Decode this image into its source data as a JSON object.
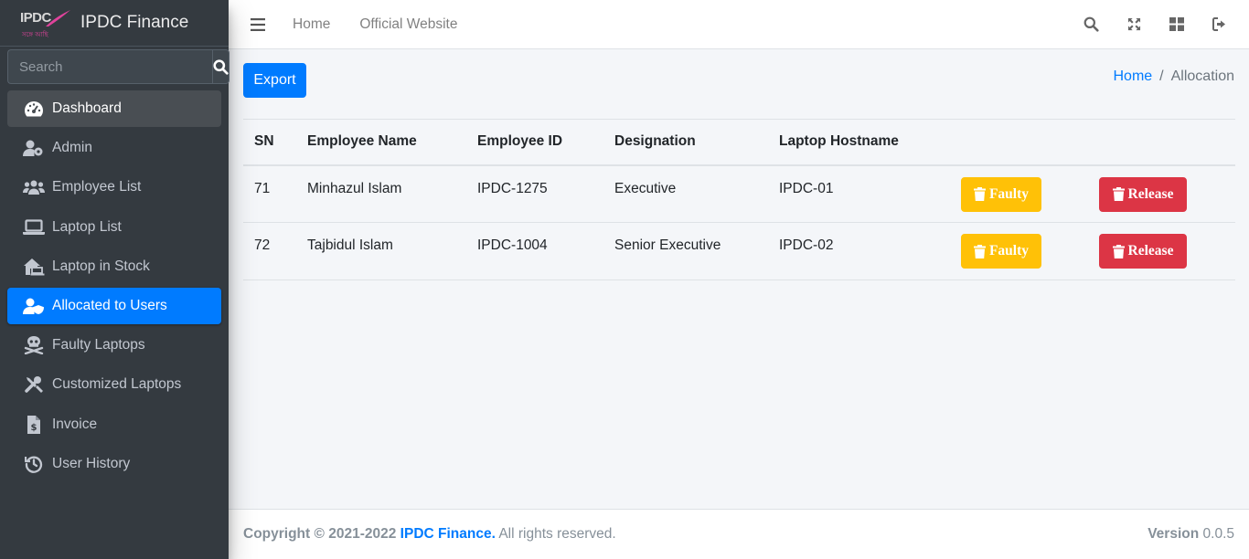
{
  "brand": {
    "logo_text": "IPDC",
    "logo_sub": "সঙ্গে আছি",
    "name": "IPDC Finance"
  },
  "search": {
    "placeholder": "Search"
  },
  "sidebar": {
    "items": [
      {
        "label": "Dashboard",
        "icon": "tachometer-icon"
      },
      {
        "label": "Admin",
        "icon": "user-cog-icon"
      },
      {
        "label": "Employee List",
        "icon": "users-icon"
      },
      {
        "label": "Laptop List",
        "icon": "laptop-icon"
      },
      {
        "label": "Laptop in Stock",
        "icon": "laptop-house-icon"
      },
      {
        "label": "Allocated to Users",
        "icon": "user-shield-icon"
      },
      {
        "label": "Faulty Laptops",
        "icon": "skull-crossbones-icon"
      },
      {
        "label": "Customized Laptops",
        "icon": "tools-icon"
      },
      {
        "label": "Invoice",
        "icon": "file-invoice-dollar-icon"
      },
      {
        "label": "User History",
        "icon": "history-icon"
      }
    ],
    "active": "Allocated to Users"
  },
  "topbar": {
    "links": [
      "Home",
      "Official Website"
    ]
  },
  "toolbar": {
    "export_label": "Export"
  },
  "breadcrumb": {
    "home": "Home",
    "separator": "/",
    "current": "Allocation"
  },
  "table": {
    "headers": [
      "SN",
      "Employee Name",
      "Employee ID",
      "Designation",
      "Laptop Hostname"
    ],
    "rows": [
      {
        "sn": "71",
        "name": "Minhazul Islam",
        "id": "IPDC-1275",
        "designation": "Executive",
        "hostname": "IPDC-01"
      },
      {
        "sn": "72",
        "name": "Tajbidul Islam",
        "id": "IPDC-1004",
        "designation": "Senior Executive",
        "hostname": "IPDC-02"
      }
    ],
    "faulty_label": "Faulty",
    "release_label": "Release"
  },
  "footer": {
    "copyright": "Copyright © 2021-2022",
    "brand": "IPDC Finance.",
    "rights": "All rights reserved.",
    "version_label": "Version",
    "version": "0.0.5"
  },
  "colors": {
    "primary": "#007bff",
    "warning": "#ffc107",
    "danger": "#dc3545",
    "sidebar": "#343a40"
  }
}
